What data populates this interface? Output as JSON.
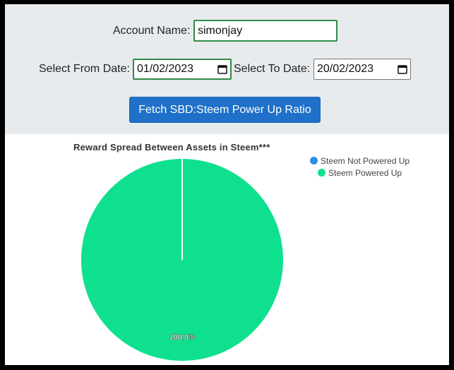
{
  "form": {
    "account_label": "Account Name:",
    "account_value": "simonjay",
    "from_label": "Select From Date:",
    "from_value": "01/02/2023",
    "to_label": "Select To Date:",
    "to_value": "20/02/2023",
    "fetch_label": "Fetch SBD:Steem Power Up Ratio"
  },
  "chart_data": {
    "type": "pie",
    "title": "Reward Spread Between Assets in Steem***",
    "legend_position": "top-right",
    "series": [
      {
        "name": "Steem Not Powered Up",
        "value": 0,
        "color": "#2e8fe0"
      },
      {
        "name": "Steem Powered Up",
        "value": 100,
        "color": "#0fe08f"
      }
    ],
    "data_labels": [
      "100.0%"
    ]
  },
  "icons": [
    "calendar-icon",
    "calendar-icon"
  ]
}
